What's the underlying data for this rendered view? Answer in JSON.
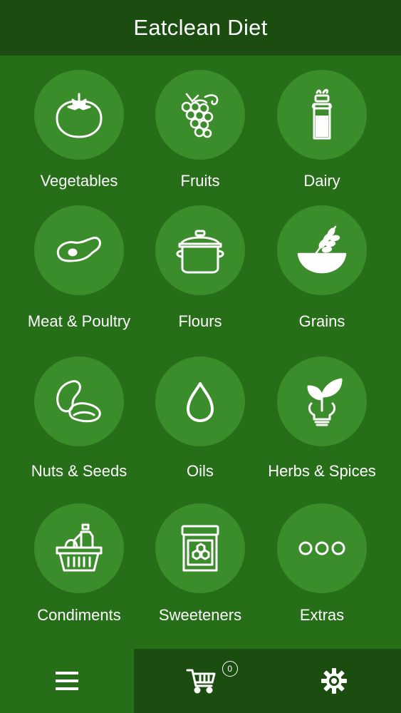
{
  "app": {
    "title": "Eatclean Diet"
  },
  "categories": [
    {
      "label": "Vegetables",
      "icon": "tomato-icon"
    },
    {
      "label": "Fruits",
      "icon": "grapes-icon"
    },
    {
      "label": "Dairy",
      "icon": "milk-bottle-icon"
    },
    {
      "label": "Meat & Poultry",
      "icon": "meat-icon"
    },
    {
      "label": "Flours",
      "icon": "pot-icon"
    },
    {
      "label": "Grains",
      "icon": "grain-bowl-icon"
    },
    {
      "label": "Nuts & Seeds",
      "icon": "nuts-icon"
    },
    {
      "label": "Oils",
      "icon": "oil-drop-icon"
    },
    {
      "label": "Herbs & Spices",
      "icon": "herb-bulb-icon"
    },
    {
      "label": "Condiments",
      "icon": "basket-icon"
    },
    {
      "label": "Sweeteners",
      "icon": "honey-jar-icon"
    },
    {
      "label": "Extras",
      "icon": "more-dots-icon"
    }
  ],
  "tabbar": {
    "tabs": [
      {
        "icon": "menu-icon"
      },
      {
        "icon": "cart-icon",
        "badge": "0"
      },
      {
        "icon": "gear-icon"
      }
    ]
  },
  "colors": {
    "background": "#266e18",
    "header": "#1b4d10",
    "circle": "#3b8c2a",
    "text": "#ffffff"
  }
}
